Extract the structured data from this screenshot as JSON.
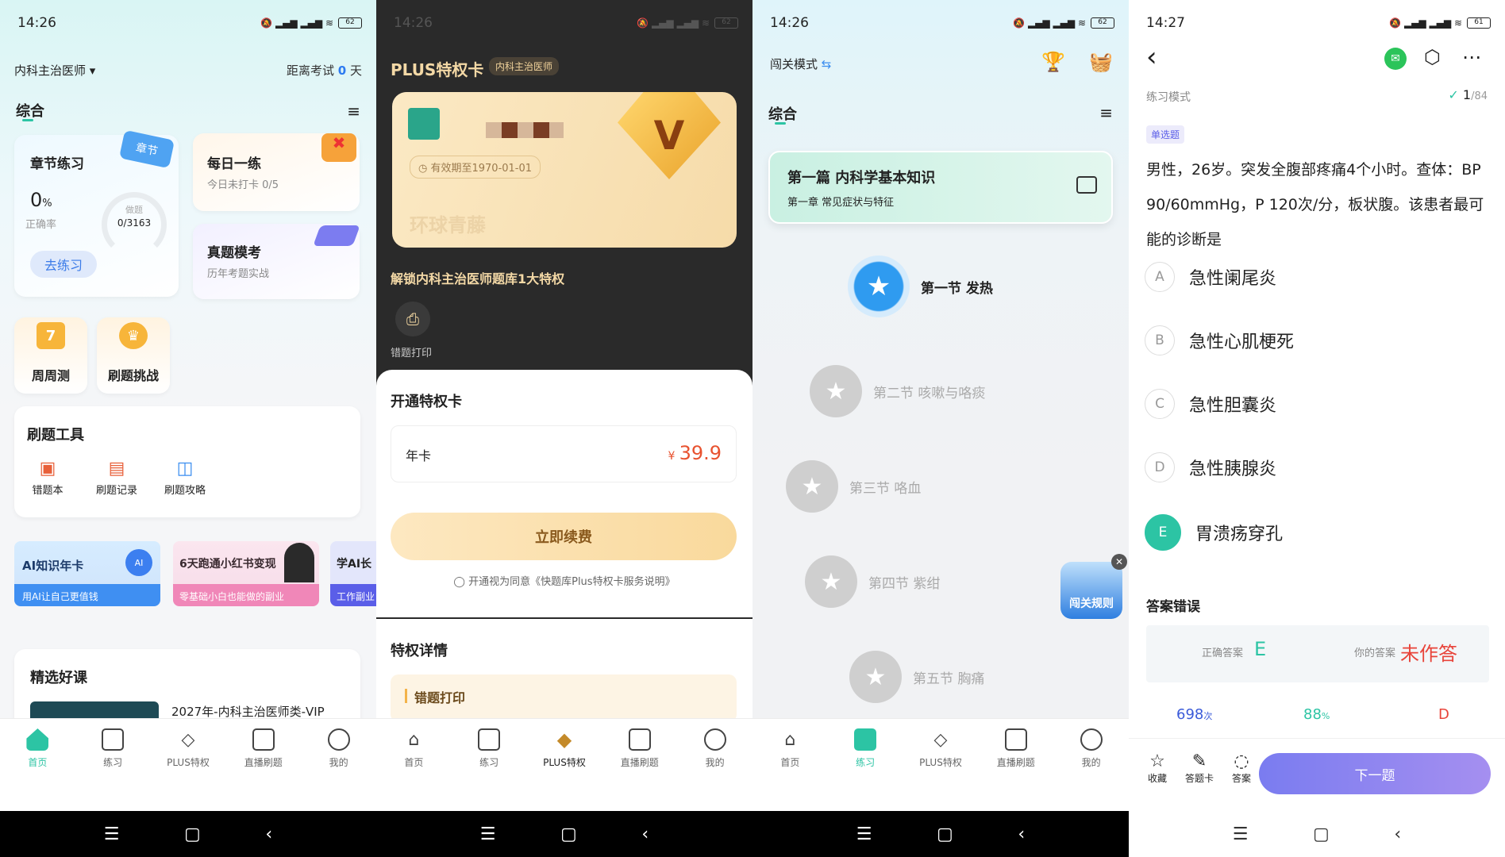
{
  "p1": {
    "time": "14:26",
    "battery": "62",
    "exam_selector": "内科主治医师 ▾",
    "countdown_prefix": "距离考试",
    "countdown_value": "0",
    "countdown_suffix": "天",
    "tab_label": "综合",
    "chapter": {
      "title": "章节练习",
      "badge": "章节",
      "percent": "0",
      "percent_unit": "%",
      "rate_label": "正确率",
      "done_label": "做题",
      "done_value": "0/3163",
      "go_button": "去练习"
    },
    "daily": {
      "title": "每日一练",
      "sub": "今日未打卡 0/5"
    },
    "mock": {
      "title": "真题模考",
      "sub": "历年考题实战"
    },
    "weekly": {
      "title": "周周测",
      "badge": "7"
    },
    "challenge": {
      "title": "刷题挑战"
    },
    "tools": {
      "title": "刷题工具",
      "items": [
        "错题本",
        "刷题记录",
        "刷题攻略"
      ]
    },
    "banners": [
      {
        "title": "AI知识年卡",
        "sub": "用AI让自己更值钱",
        "tag": "AI"
      },
      {
        "title": "6天跑通小红书变现",
        "sub": "零基础小白也能做的副业"
      },
      {
        "title": "学AI长",
        "sub": "工作副业"
      }
    ],
    "courses": {
      "title": "精选好课",
      "first": "2027年-内科主治医师类-VIP"
    }
  },
  "p2": {
    "time": "14:26",
    "battery": "62",
    "title": "PLUS特权卡",
    "tag": "内科主治医师",
    "validity": "有效期至1970-01-01",
    "brand": "环球青藤",
    "unlock_text": "解锁内科主治医师题库1大特权",
    "privilege_icon_label": "错题打印",
    "open_title": "开通特权卡",
    "plan_name": "年卡",
    "price_symbol": "¥",
    "price": "39.9",
    "renew_button": "立即续费",
    "agreement": "开通视为同意《快题库Plus特权卡服务说明》",
    "details_title": "特权详情",
    "detail_item": "错题打印"
  },
  "p3": {
    "time": "14:26",
    "battery": "62",
    "mode": "闯关模式",
    "tab_label": "综合",
    "part_title": "第一篇  内科学基本知识",
    "part_sub": "第一章  常见症状与特征",
    "sections": [
      "第一节  发热",
      "第二节  咳嗽与咯痰",
      "第三节  咯血",
      "第四节  紫绀",
      "第五节  胸痛"
    ],
    "rules_badge": "闯关规则"
  },
  "p4": {
    "time": "14:27",
    "battery": "61",
    "mode": "练习模式",
    "progress_current": "1",
    "progress_total": "/84",
    "qtype": "单选题",
    "question": "男性，26岁。突发全腹部疼痛4个小时。查体：BP 90/60mmHg，P 120次/分，板状腹。该患者最可能的诊断是",
    "options": [
      {
        "letter": "A",
        "text": "急性阑尾炎"
      },
      {
        "letter": "B",
        "text": "急性心肌梗死"
      },
      {
        "letter": "C",
        "text": "急性胆囊炎"
      },
      {
        "letter": "D",
        "text": "急性胰腺炎"
      },
      {
        "letter": "E",
        "text": "胃溃疡穿孔"
      }
    ],
    "result_title": "答案错误",
    "correct_label": "正确答案",
    "correct_value": "E",
    "your_label": "你的答案",
    "your_value": "未作答",
    "stats": [
      {
        "v": "698",
        "u": "次"
      },
      {
        "v": "88",
        "u": "%"
      },
      {
        "v": "D",
        "u": ""
      }
    ],
    "bottom": {
      "fav": "收藏",
      "sheet": "答题卡",
      "answer": "答案",
      "next": "下一题"
    }
  },
  "tabs": [
    "首页",
    "练习",
    "PLUS特权",
    "直播刷题",
    "我的"
  ],
  "colors": {
    "accent": "#2cc4a4",
    "blue": "#3b8ef0",
    "price": "#e8522f",
    "wrong": "#e8443a",
    "next": "#8a7cf0"
  }
}
